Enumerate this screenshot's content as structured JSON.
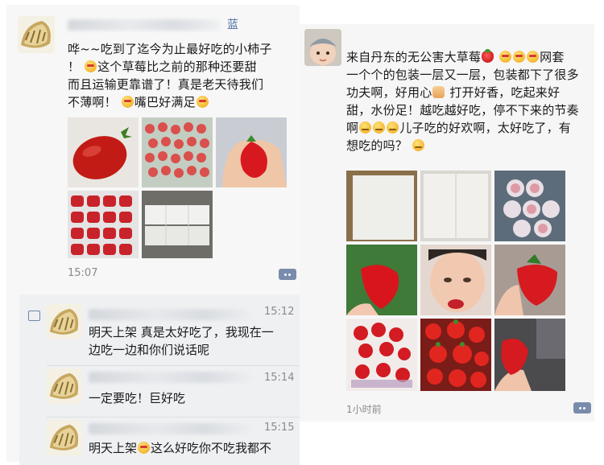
{
  "left_post": {
    "author_suffix": "蓝",
    "text_line1": "哗~~吃到了迄今为止最好吃的小柿子",
    "text_line2a": "！",
    "text_line2b": "这个草莓比之前的那种还要甜",
    "text_line3": "而且运输更靠谱了！真是老天待我们",
    "text_line4a": "不薄啊！",
    "text_line4b": "嘴巴好满足",
    "time": "15:07",
    "photos": [
      "tomato-photo",
      "strawberry-box-photo",
      "strawberry-in-hand-photo",
      "strawberry-tray-photo",
      "packaging-box-photo"
    ]
  },
  "comments": [
    {
      "time": "15:12",
      "line1": "明天上架 真是太好吃了，我现在一",
      "line2": "边吃一边和你们说话呢"
    },
    {
      "time": "15:14",
      "line1": "一定要吃！巨好吃",
      "line2": ""
    },
    {
      "time": "15:15",
      "line1a": "明天上架",
      "line1b": "这么好吃你不吃我都不"
    }
  ],
  "right_post": {
    "line1a": "来自丹东的无公害大草莓",
    "line1b": "网套",
    "line2": "一个个的包装一层又一层，包装都下了很多",
    "line3a": "功夫啊，好用心",
    "line3b": "打开好香，吃起来好",
    "line4": "甜，水份足！越吃越好吃，停不下来的节奏",
    "line5a": "啊",
    "line5b": "儿子吃的好欢啊，太好吃了，有",
    "line6a": "想吃的吗？",
    "time": "1小时前"
  },
  "colors": {
    "link_blue": "#4a6fa5",
    "strawberry_red": "#d7262b",
    "more_button": "#7a8cab"
  }
}
